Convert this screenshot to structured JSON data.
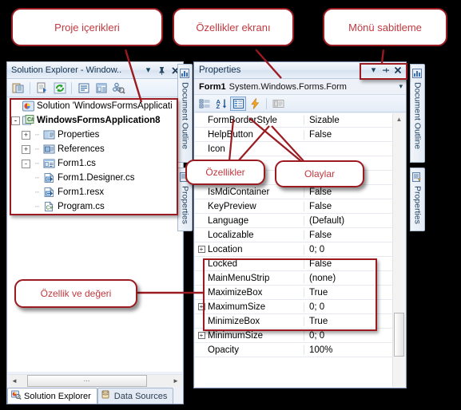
{
  "callouts": [
    {
      "id": "proje-icerikleri",
      "text": "Proje içerikleri"
    },
    {
      "id": "ozellikler-ekrani",
      "text": "Özellikler ekranı"
    },
    {
      "id": "monu-sabitleme",
      "text": "Mönü sabitleme"
    },
    {
      "id": "ozellikler",
      "text": "Özellikler"
    },
    {
      "id": "olaylar",
      "text": "Olaylar"
    },
    {
      "id": "ozellik-ve-degeri",
      "text": "Özellik ve değeri"
    }
  ],
  "solution_explorer": {
    "title": "Solution Explorer - Window..",
    "titlebar_buttons": [
      {
        "name": "dropdown",
        "glyph": "▾"
      },
      {
        "name": "pin",
        "glyph": "⇱"
      },
      {
        "name": "close",
        "glyph": "✕"
      }
    ],
    "toolbar": [
      {
        "name": "properties-window-icon"
      },
      {
        "name": "show-all-files-icon"
      },
      {
        "name": "refresh-icon"
      },
      {
        "name": "view-code-icon"
      },
      {
        "name": "view-designer-icon"
      },
      {
        "name": "view-class-diagram-icon"
      }
    ],
    "tree": [
      {
        "label": "Solution 'WindowsFormsApplicati",
        "depth": 0,
        "expander": "",
        "icon": "solution-icon",
        "bold": false
      },
      {
        "label": "WindowsFormsApplication8",
        "depth": 1,
        "expander": "-",
        "icon": "csharp-project-icon",
        "bold": true
      },
      {
        "label": "Properties",
        "depth": 2,
        "expander": "+",
        "icon": "properties-folder-icon",
        "bold": false
      },
      {
        "label": "References",
        "depth": 2,
        "expander": "+",
        "icon": "references-folder-icon",
        "bold": false
      },
      {
        "label": "Form1.cs",
        "depth": 2,
        "expander": "-",
        "icon": "form-icon",
        "bold": false
      },
      {
        "label": "Form1.Designer.cs",
        "depth": 3,
        "expander": "",
        "icon": "designer-file-icon",
        "bold": false
      },
      {
        "label": "Form1.resx",
        "depth": 3,
        "expander": "",
        "icon": "resx-file-icon",
        "bold": false
      },
      {
        "label": "Program.cs",
        "depth": 2,
        "expander": "",
        "icon": "csharp-file-icon",
        "bold": false
      }
    ],
    "hscroll": {
      "left_glyph": "◄",
      "right_glyph": "►",
      "thumb_glyph": "⋯"
    },
    "tabs": [
      {
        "label": "Solution Explorer",
        "active": true,
        "icon": "solution-explorer-icon"
      },
      {
        "label": "Data Sources",
        "active": false,
        "icon": "data-sources-icon"
      }
    ]
  },
  "vertical_tabs_left": [
    {
      "label": "Document Outline",
      "icon": "document-outline-icon"
    },
    {
      "label": "Properties",
      "icon": "properties-icon"
    }
  ],
  "vertical_tabs_right": [
    {
      "label": "Document Outline",
      "icon": "document-outline-icon"
    },
    {
      "label": "Properties",
      "icon": "properties-icon"
    }
  ],
  "properties_window": {
    "title": "Properties",
    "titlebar_buttons": [
      {
        "name": "dropdown",
        "glyph": "▾"
      },
      {
        "name": "pin",
        "glyph": "⇱"
      },
      {
        "name": "close",
        "glyph": "✕"
      }
    ],
    "object_name": "Form1",
    "object_type": "System.Windows.Forms.Form",
    "object_dropdown_glyph": "▾",
    "toolbar": [
      {
        "name": "categorized-button",
        "selected": false
      },
      {
        "name": "alphabetical-button",
        "selected": false
      },
      {
        "name": "properties-button",
        "selected": true
      },
      {
        "name": "events-button",
        "selected": false
      },
      {
        "name": "property-pages-button",
        "selected": false
      }
    ],
    "rows": [
      {
        "name": "FormBorderStyle",
        "value": "Sizable",
        "expander": ""
      },
      {
        "name": "HelpButton",
        "value": "False",
        "expander": ""
      },
      {
        "name": "Icon",
        "value": "",
        "expander": ""
      },
      {
        "name": "",
        "value": "",
        "expander": ""
      },
      {
        "name": "",
        "value": "",
        "expander": ""
      },
      {
        "name": "IsMdiContainer",
        "value": "False",
        "expander": ""
      },
      {
        "name": "KeyPreview",
        "value": "False",
        "expander": ""
      },
      {
        "name": "Language",
        "value": "(Default)",
        "expander": ""
      },
      {
        "name": "Localizable",
        "value": "False",
        "expander": ""
      },
      {
        "name": "Location",
        "value": "0; 0",
        "expander": "+"
      },
      {
        "name": "Locked",
        "value": "False",
        "expander": ""
      },
      {
        "name": "MainMenuStrip",
        "value": "(none)",
        "expander": ""
      },
      {
        "name": "MaximizeBox",
        "value": "True",
        "expander": ""
      },
      {
        "name": "MaximumSize",
        "value": "0; 0",
        "expander": "+"
      },
      {
        "name": "MinimizeBox",
        "value": "True",
        "expander": ""
      },
      {
        "name": "MinimumSize",
        "value": "0; 0",
        "expander": "+"
      },
      {
        "name": "Opacity",
        "value": "100%",
        "expander": ""
      }
    ],
    "scrollbar": {
      "up_glyph": "▲",
      "down_glyph": "▼"
    }
  },
  "colors": {
    "annotation_red": "#9c1b21",
    "annotation_text": "#c0393f",
    "chrome_blue": "#eef2f8",
    "backdrop": "#000000"
  }
}
